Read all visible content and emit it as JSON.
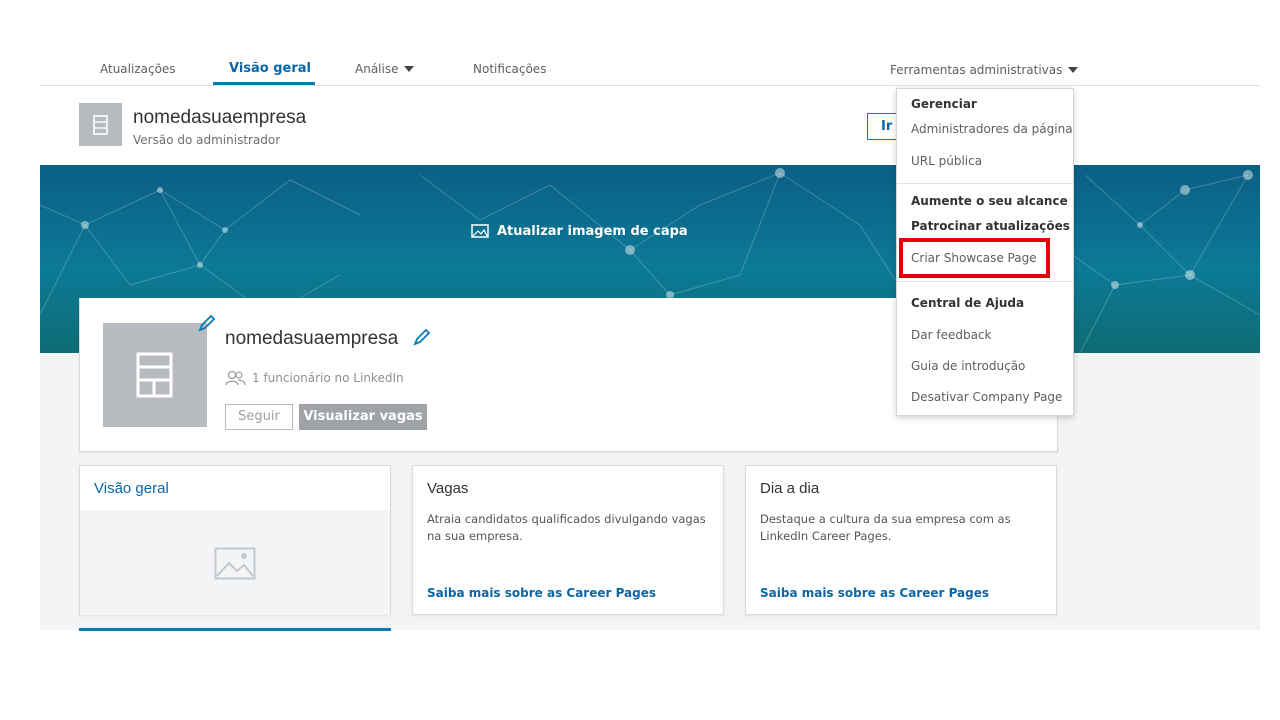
{
  "nav": {
    "tabs": [
      {
        "label": "Atualizações"
      },
      {
        "label": "Visão geral"
      },
      {
        "label": "Análise"
      },
      {
        "label": "Notificações"
      }
    ],
    "admin_tools_label": "Ferramentas administrativas"
  },
  "header": {
    "company_name": "nomedasuaempresa",
    "admin_version": "Versão do administrador",
    "ir_button": "Ir"
  },
  "banner": {
    "update_cover_label": "Atualizar imagem de capa"
  },
  "profile": {
    "company_name": "nomedasuaempresa",
    "employees": "1 funcionário no LinkedIn",
    "follow_label": "Seguir",
    "jobs_label": "Visualizar vagas"
  },
  "cards": [
    {
      "title": "Visão geral"
    },
    {
      "title": "Vagas",
      "description": "Atraia candidatos qualificados divulgando vagas na sua empresa.",
      "link": "Saiba mais sobre as Career Pages"
    },
    {
      "title": "Dia a dia",
      "description": "Destaque a cultura da sua empresa com as LinkedIn Career Pages.",
      "link": "Saiba mais sobre as Career Pages"
    }
  ],
  "dropdown": {
    "sections": [
      {
        "items": [
          "Gerenciar",
          "Administradores da página",
          "URL pública"
        ]
      },
      {
        "items": [
          "Aumente o seu alcance",
          "Patrocinar atualizações",
          "Criar Showcase Page"
        ]
      },
      {
        "items": [
          "Central de Ajuda",
          "Dar feedback",
          "Guia de introdução",
          "Desativar Company Page"
        ]
      }
    ],
    "highlighted_item": "Criar Showcase Page"
  },
  "colors": {
    "accent": "#0a66a8",
    "banner": "#0c7a96",
    "highlight": "#e3000b"
  }
}
